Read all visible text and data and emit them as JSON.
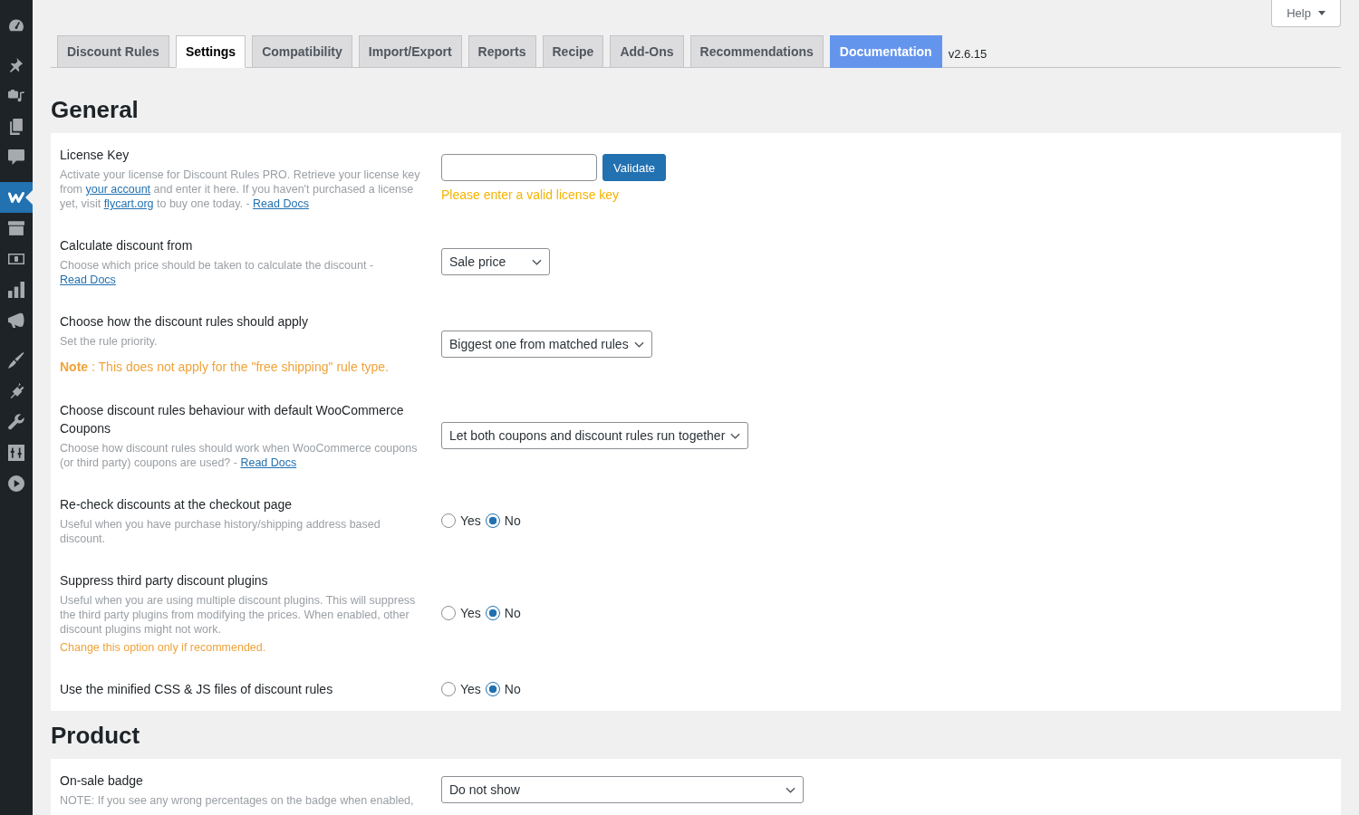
{
  "sidebar": {
    "groups": [
      [
        {
          "selected": false
        }
      ],
      [
        {
          "selected": false
        },
        {
          "selected": false
        },
        {
          "selected": false
        },
        {
          "selected": false
        }
      ],
      [
        {
          "selected": true
        },
        {
          "selected": false
        },
        {
          "selected": false
        },
        {
          "selected": false
        },
        {
          "selected": false
        }
      ],
      [
        {
          "selected": false
        },
        {
          "selected": false
        },
        {
          "selected": false
        },
        {
          "selected": false
        },
        {
          "selected": false
        }
      ]
    ]
  },
  "help_button": {
    "label": "Help"
  },
  "tabs": [
    {
      "label": "Discount Rules",
      "selected": false,
      "highlighted": false
    },
    {
      "label": "Settings",
      "selected": true,
      "highlighted": false
    },
    {
      "label": "Compatibility",
      "selected": false,
      "highlighted": false
    },
    {
      "label": "Import/Export",
      "selected": false,
      "highlighted": false
    },
    {
      "label": "Reports",
      "selected": false,
      "highlighted": false
    },
    {
      "label": "Recipe",
      "selected": false,
      "highlighted": false
    },
    {
      "label": "Add-Ons",
      "selected": false,
      "highlighted": false
    },
    {
      "label": "Recommendations",
      "selected": false,
      "highlighted": false
    },
    {
      "label": "Documentation",
      "selected": false,
      "highlighted": true
    }
  ],
  "version": "v2.6.15",
  "sections": [
    {
      "title": "General",
      "rows": [
        {
          "label": "License Key",
          "description": [
            {
              "kind": "text",
              "text": "Activate your license for Discount Rules PRO. Retrieve your license key from "
            },
            {
              "kind": "link",
              "text": "your account"
            },
            {
              "kind": "text",
              "text": " and enter it here. If you haven't purchased a license yet, visit "
            },
            {
              "kind": "link",
              "text": "flycart.org"
            },
            {
              "kind": "text",
              "text": " to buy one today. - "
            },
            {
              "kind": "link",
              "text": "Read Docs"
            }
          ],
          "control": {
            "kind": "license",
            "button": "Validate",
            "error": "Please enter a valid license key"
          }
        },
        {
          "label": "Calculate discount from",
          "description": [
            {
              "kind": "text",
              "text": "Choose which price should be taken to calculate the discount - "
            },
            {
              "kind": "link",
              "text": "Read Docs"
            }
          ],
          "control": {
            "kind": "select",
            "value": "Sale price"
          }
        },
        {
          "label": "Choose how the discount rules should apply",
          "description": [
            {
              "kind": "text",
              "text": "Set the rule priority."
            }
          ],
          "note": {
            "kind": "notice",
            "text": "**Note** : This does not apply for the \"free shipping\" rule type."
          },
          "control": {
            "kind": "select",
            "value": "Biggest one from matched rules"
          }
        },
        {
          "label": "Choose discount rules behaviour with default WooCommerce Coupons",
          "description": [
            {
              "kind": "text",
              "text": "Choose how discount rules should work when WooCommerce coupons (or third party) coupons are used? - "
            },
            {
              "kind": "link",
              "text": "Read Docs"
            }
          ],
          "control": {
            "kind": "select",
            "value": "Let both coupons and discount rules run together"
          }
        },
        {
          "label": "Re-check discounts at the checkout page",
          "description": [
            {
              "kind": "text",
              "text": "Useful when you have purchase history/shipping address based discount."
            }
          ],
          "control": {
            "kind": "radio",
            "options": [
              {
                "label": "Yes",
                "selected": false
              },
              {
                "label": "No",
                "selected": true
              }
            ]
          }
        },
        {
          "label": "Suppress third party discount plugins",
          "description": [
            {
              "kind": "text",
              "text": "Useful when you are using multiple discount plugins. This will suppress the third party plugins from modifying the prices. When enabled, other discount plugins might not work."
            }
          ],
          "note": {
            "kind": "hint",
            "text": "Change this option only if recommended."
          },
          "control": {
            "kind": "radio",
            "options": [
              {
                "label": "Yes",
                "selected": false
              },
              {
                "label": "No",
                "selected": true
              }
            ]
          }
        },
        {
          "label": "Use the minified CSS & JS files of discount rules",
          "control": {
            "kind": "radio",
            "options": [
              {
                "label": "Yes",
                "selected": false
              },
              {
                "label": "No",
                "selected": true
              }
            ]
          }
        }
      ]
    },
    {
      "title": "Product",
      "rows": [
        {
          "label": "On-sale badge",
          "description": [
            {
              "kind": "text",
              "text": "NOTE: If you see any wrong percentages on the badge when enabled,"
            }
          ],
          "control": {
            "kind": "select",
            "value": "Do not show"
          }
        }
      ]
    }
  ]
}
